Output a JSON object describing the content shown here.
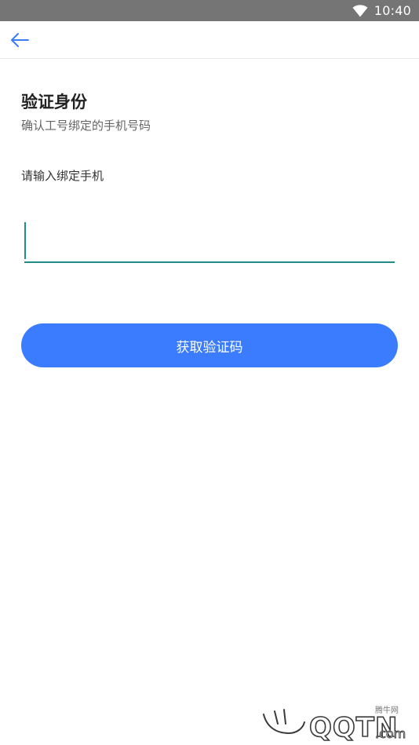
{
  "status_bar": {
    "time": "10:40",
    "icons": [
      "wifi-icon"
    ]
  },
  "app_bar": {
    "back_icon": "back-arrow-icon",
    "accent_color": "#3b7cff"
  },
  "content": {
    "title": "验证身份",
    "subtitle": "确认工号绑定的手机号码",
    "phone_label": "请输入绑定手机",
    "phone_value": "",
    "phone_placeholder": "",
    "input_accent_color": "#1f8e8a"
  },
  "actions": {
    "get_code_label": "获取验证码",
    "button_color": "#3b7cff"
  },
  "watermark": {
    "logo_text": "QQTN.com",
    "caption": "腾牛网"
  }
}
